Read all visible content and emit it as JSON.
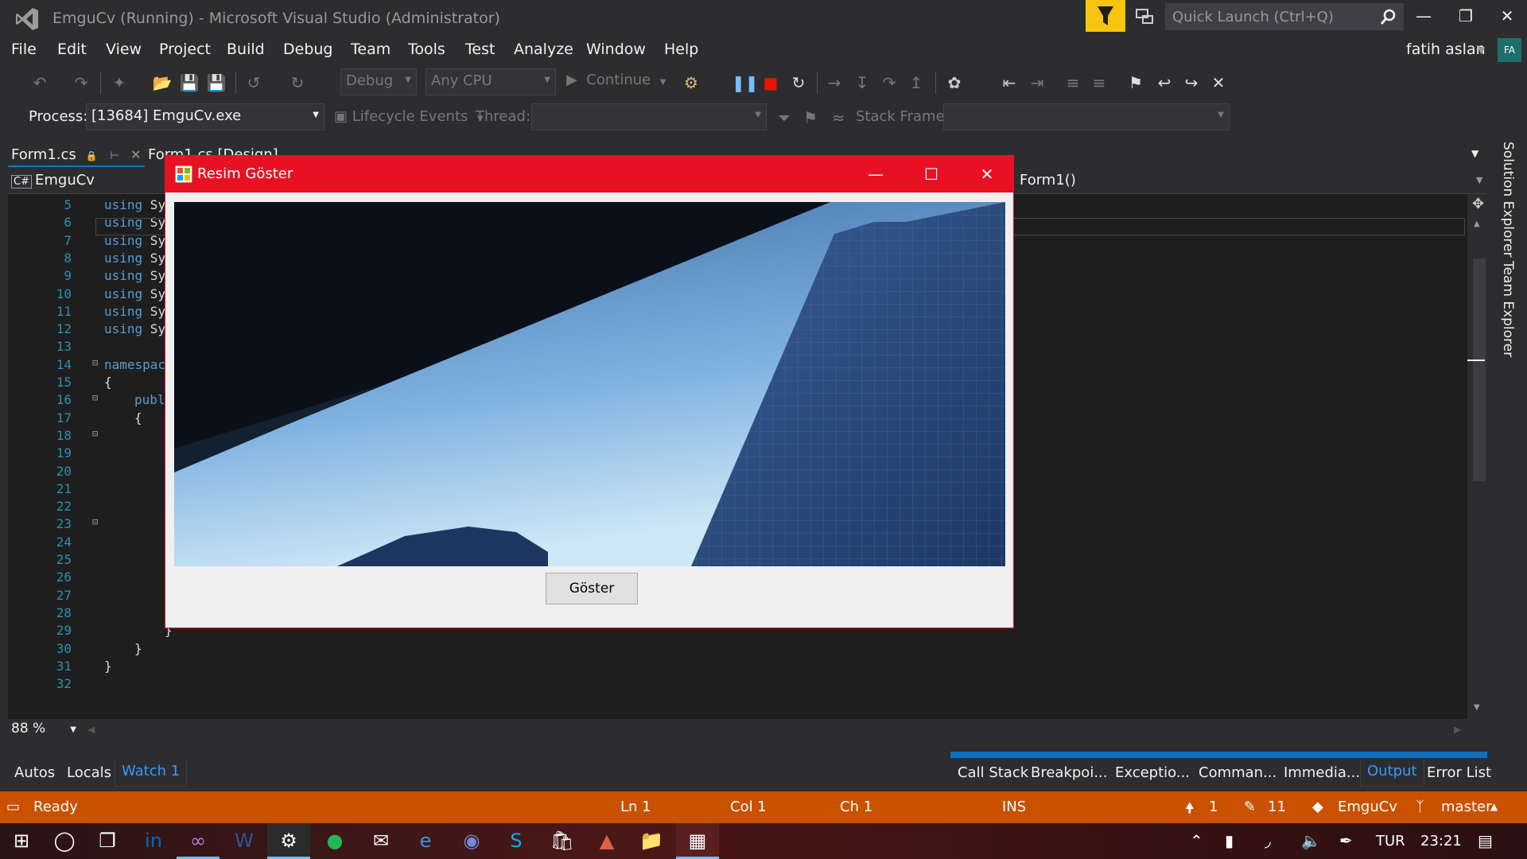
{
  "window": {
    "title": "EmguCv (Running) - Microsoft Visual Studio  (Administrator)",
    "quick_launch_placeholder": "Quick Launch (Ctrl+Q)",
    "user": "fatih aslan",
    "avatar_initials": "FA"
  },
  "menu": [
    "File",
    "Edit",
    "View",
    "Project",
    "Build",
    "Debug",
    "Team",
    "Tools",
    "Test",
    "Analyze",
    "Window",
    "Help"
  ],
  "toolbar": {
    "config": "Debug",
    "platform": "Any CPU",
    "continue_label": "Continue",
    "process_label": "Process:",
    "process_value": "[13684] EmguCv.exe",
    "lifecycle_label": "Lifecycle Events",
    "thread_label": "Thread:",
    "stack_frame_label": "Stack Frame:"
  },
  "doc_tabs": [
    "Form1.cs",
    "Form1.cs [Design]"
  ],
  "nav": {
    "project": "EmguCv",
    "member": "Form1()"
  },
  "editor": {
    "line_numbers": [
      "5",
      "6",
      "7",
      "8",
      "9",
      "10",
      "11",
      "12",
      "13",
      "14",
      "15",
      "16",
      "17",
      "18",
      "19",
      "20",
      "21",
      "22",
      "23",
      "24",
      "25",
      "26",
      "27",
      "28",
      "29",
      "30",
      "31",
      "32"
    ],
    "using_prefix": "using Sy",
    "namespace_prefix": "namespac",
    "public_prefix": "publ",
    "brace_open": "{",
    "brace_close": "}",
    "zoom": "88 %"
  },
  "side_tabs": [
    "Solution Explorer",
    "Team Explorer"
  ],
  "bottom_tabs_left": [
    "Autos",
    "Locals",
    "Watch 1"
  ],
  "bottom_tabs_right": [
    "Call Stack",
    "Breakpoi...",
    "Exceptio...",
    "Comman...",
    "Immedia...",
    "Output",
    "Error List"
  ],
  "status": {
    "ready": "Ready",
    "ln": "Ln 1",
    "col": "Col 1",
    "ch": "Ch 1",
    "ins": "INS",
    "up_count": "1",
    "pencil_count": "11",
    "repo": "EmguCv",
    "branch": "master"
  },
  "form": {
    "title": "Resim Göster",
    "button_label": "Göster"
  },
  "tray": {
    "lang": "TUR",
    "time": "23:21"
  },
  "colors": {
    "status_bar": "#ca5100",
    "form_title": "#e81123",
    "filter": "#f5c50f"
  }
}
